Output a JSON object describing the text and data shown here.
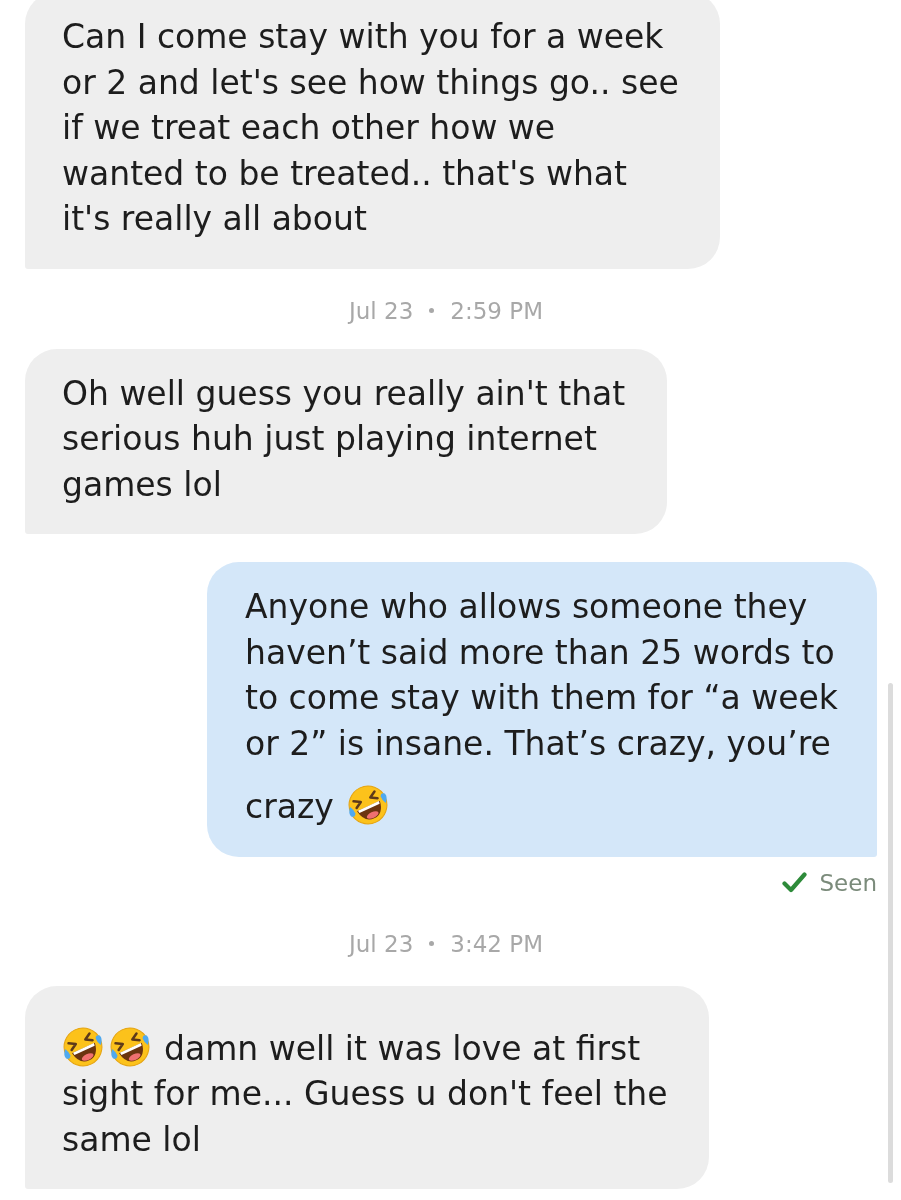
{
  "thread": [
    {
      "kind": "message",
      "outgoing": false,
      "parts": [
        {
          "kind": "text",
          "text": "Can I come stay with you for a week or 2 and let's see how things go.. see if we treat each other how we wanted to be treated.. that's what it's really all about"
        }
      ]
    },
    {
      "kind": "timestamp",
      "date": "Jul 23",
      "time": "2:59 PM"
    },
    {
      "kind": "message",
      "outgoing": false,
      "parts": [
        {
          "kind": "text",
          "text": "Oh well guess you really ain't that serious huh just playing internet games lol"
        }
      ]
    },
    {
      "kind": "message",
      "outgoing": true,
      "parts": [
        {
          "kind": "text",
          "text": "Anyone who allows someone they haven’t said more than 25 words to to come stay with them for “a week or 2” is insane. That’s crazy, you’re crazy"
        },
        {
          "kind": "emoji"
        }
      ]
    },
    {
      "kind": "receipt",
      "label": "Seen"
    },
    {
      "kind": "timestamp",
      "date": "Jul 23",
      "time": "3:42 PM"
    },
    {
      "kind": "message",
      "outgoing": false,
      "parts": [
        {
          "kind": "emoji"
        },
        {
          "kind": "emoji"
        },
        {
          "kind": "text",
          "text": "damn well it was love at first sight for me... Guess u don't feel the same lol"
        }
      ]
    }
  ]
}
